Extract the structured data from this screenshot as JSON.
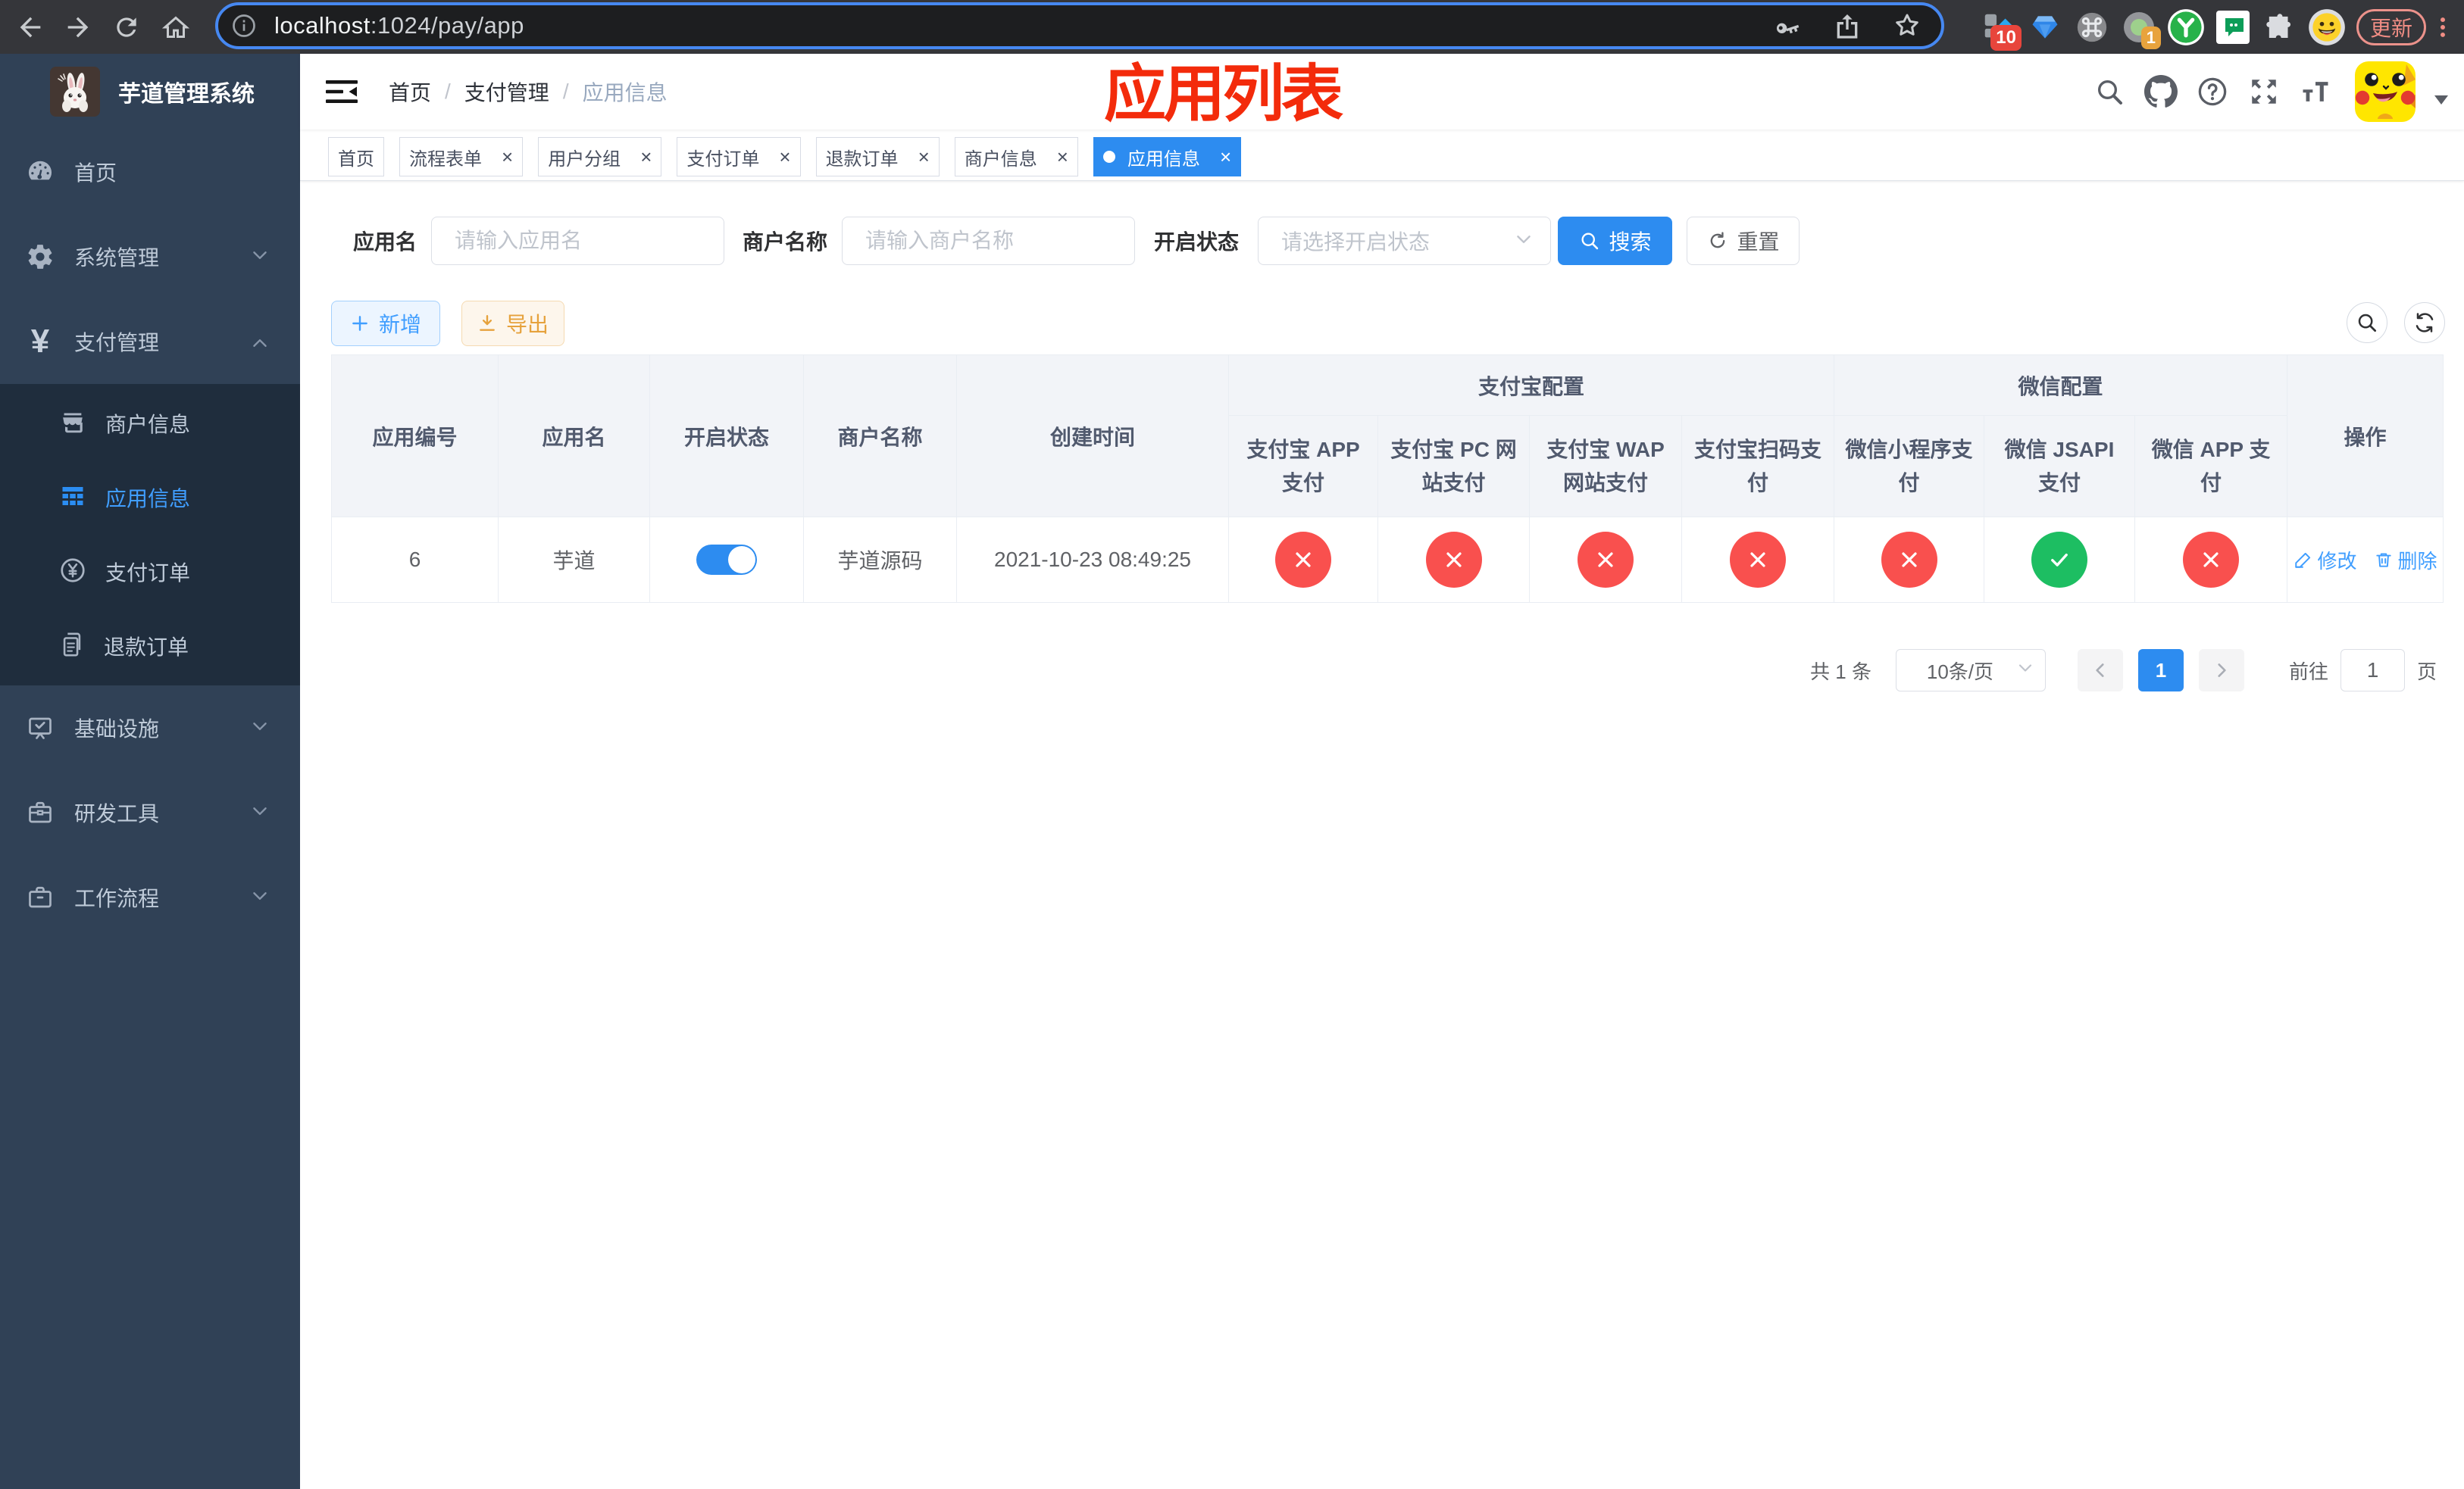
{
  "browser": {
    "url_host": "localhost",
    "url_path": ":1024/pay/app",
    "extension_badge_count": "10",
    "profile_badge_count": "1",
    "update_button": "更新"
  },
  "sidebar": {
    "logo_title": "芋道管理系统",
    "menu": [
      {
        "label": "首页"
      },
      {
        "label": "系统管理"
      },
      {
        "label": "支付管理"
      },
      {
        "label": "基础设施"
      },
      {
        "label": "研发工具"
      },
      {
        "label": "工作流程"
      }
    ],
    "submenu": [
      {
        "label": "商户信息"
      },
      {
        "label": "应用信息"
      },
      {
        "label": "支付订单"
      },
      {
        "label": "退款订单"
      }
    ]
  },
  "navbar": {
    "breadcrumb": [
      "首页",
      "支付管理",
      "应用信息"
    ],
    "annotation": "应用列表"
  },
  "tabs": [
    {
      "label": "首页"
    },
    {
      "label": "流程表单"
    },
    {
      "label": "用户分组"
    },
    {
      "label": "支付订单"
    },
    {
      "label": "退款订单"
    },
    {
      "label": "商户信息"
    },
    {
      "label": "应用信息"
    }
  ],
  "filter": {
    "app_name_label": "应用名",
    "app_name_placeholder": "请输入应用名",
    "merchant_label": "商户名称",
    "merchant_placeholder": "请输入商户名称",
    "status_label": "开启状态",
    "status_placeholder": "请选择开启状态",
    "search_button": "搜索",
    "reset_button": "重置"
  },
  "toolbar": {
    "add_button": "新增",
    "export_button": "导出"
  },
  "table": {
    "columns": {
      "app_id": "应用编号",
      "app_name": "应用名",
      "status": "开启状态",
      "merchant_name": "商户名称",
      "create_time": "创建时间",
      "actions": "操作"
    },
    "group_alipay": "支付宝配置",
    "group_wechat": "微信配置",
    "alipay_columns": [
      "支付宝 APP\n支付",
      "支付宝 PC 网\n站支付",
      "支付宝 WAP\n网站支付",
      "支付宝扫码支\n付"
    ],
    "wechat_columns": [
      "微信小程序支\n付",
      "微信 JSAPI\n支付",
      "微信 APP 支\n付"
    ],
    "rows": [
      {
        "app_id": "6",
        "app_name": "芋道",
        "status": "on",
        "merchant_name": "芋道源码",
        "create_time": "2021-10-23 08:49:25",
        "alipay_app": "disabled",
        "alipay_pc": "disabled",
        "alipay_wap": "disabled",
        "alipay_qr": "disabled",
        "wechat_lite": "disabled",
        "wechat_jsapi": "enabled",
        "wechat_app": "disabled",
        "edit_label": "修改",
        "delete_label": "删除"
      }
    ]
  },
  "pagination": {
    "total_text": "共 1 条",
    "page_size": "10条/页",
    "current_page": "1",
    "goto_label": "前往",
    "goto_value": "1",
    "page_unit": "页"
  },
  "colors": {
    "accent_blue": "#2d8cf0",
    "link_blue": "#409eff",
    "danger_red": "#f9504e",
    "success_green": "#1dbe62",
    "sidebar_bg": "#304156",
    "submenu_bg": "#1f2d3d",
    "annotation_red": "#f32b0b",
    "warning_orange": "#e6a23c"
  }
}
